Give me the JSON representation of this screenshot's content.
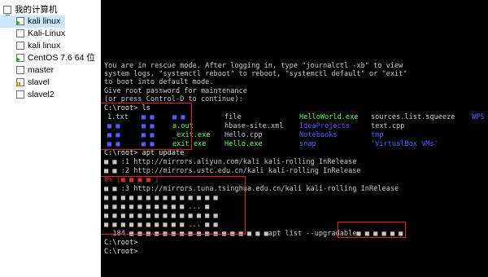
{
  "sidebar": {
    "root_label": "我的计算机",
    "items": [
      {
        "label": "kali linux",
        "state": "running",
        "selected": true
      },
      {
        "label": "Kali-Linux",
        "state": "off"
      },
      {
        "label": "kali linux",
        "state": "off"
      },
      {
        "label": "CentOS 7.6 64 位",
        "state": "running"
      },
      {
        "label": "master",
        "state": "off"
      },
      {
        "label": "slavel",
        "state": "paused"
      },
      {
        "label": "slavel2",
        "state": "off"
      }
    ]
  },
  "terminal": {
    "intro": [
      "You are in rescue mode. After logging in, type \"journalctl -xb\" to view",
      "system logs, \"systemctl reboot\" to reboot, \"systemctl default\" or \"exit\"",
      "to boot into default mode.",
      "Give root password for maintenance",
      "(or press Control-D to continue):"
    ],
    "prompt_ls": "C:\\root> ls",
    "ls_rows": [
      [
        "1.txt",
        "■ ■",
        "■ ■",
        "",
        "file",
        "HelloWorld.exe",
        "sources.list.squeeze",
        "WPS"
      ],
      [
        "■ ■",
        "■ ■",
        "",
        "a.out",
        "hbase-site.xml",
        "IdeaProjects",
        "text.cpp",
        ""
      ],
      [
        "■ ■",
        "■ ■",
        "",
        "_exit.exe",
        "Hello.cpp",
        "Notebooks",
        "tmp",
        ""
      ],
      [
        "■ ■",
        "■ ■",
        "",
        "exit.exe",
        "Hello.exe",
        "snap",
        "'VirtualBox VMs'",
        ""
      ]
    ],
    "prompt_apt_update": "C:\\root> apt update",
    "apt_lines": [
      "■ ■ :1 http://mirrors.aliyun.com/kali kali-rolling InRelease",
      "■ ■ :2 http://mirrors.ustc.edu.cn/kali kali-rolling InRelease",
      "0% [■ ■ ■ ■ ]",
      "■ ■ :3 http://mirrors.tuna.tsinghua.edu.cn/kali kali-rolling InRelease",
      "■ ■ ■ ■ ■ ■ ■ ■ ■ ■ ■ ■ ■ ■",
      "■ ■ ■ ■ ■ ■ ■ ■ ■ ■ ... ■",
      "■ ■ ■ ■ ■ ■ ■ ■ ■ ■ ■ ■ ■ ■",
      "■ ■ ■ ■ ■ ■ ■ ■ ■ ■ ... ■ ■",
      "  184 ■ ■ ■ ■ ■ ■ ■ ■ ■ ■ ■ ■ ■ ■ ■ ■ ■apt list --upgradable■ ■ ■ ■ ■ ■"
    ],
    "prompt_end_1": "C:\\root>",
    "prompt_end_2": "C:\\root>"
  },
  "colors": {
    "terminal_bg": "#000000",
    "text": "#c8c8c8",
    "exec_green": "#54ff54",
    "dir_blue": "#5a5aff",
    "link_teal": "#3fb4c8",
    "annotation_red": "#e02020",
    "selection": "#cce8ff"
  },
  "icons": {
    "root": "computer-icon",
    "vm": "vm-icon"
  }
}
